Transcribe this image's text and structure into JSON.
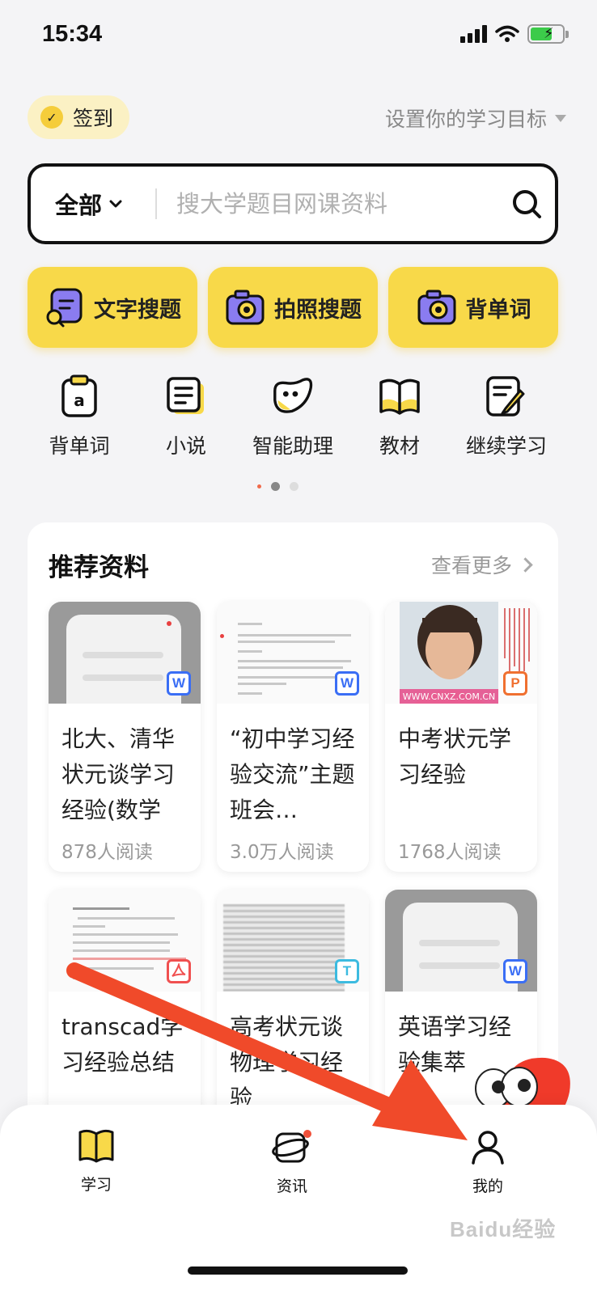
{
  "status": {
    "time": "15:34"
  },
  "checkin": {
    "label": "签到"
  },
  "goal": {
    "label": "设置你的学习目标"
  },
  "search": {
    "scope": "全部",
    "placeholder": "搜大学题目网课资料"
  },
  "big_actions": [
    {
      "label": "文字搜题",
      "icon": "text-search-icon"
    },
    {
      "label": "拍照搜题",
      "icon": "camera-icon"
    },
    {
      "label": "背单词",
      "icon": "camera-icon"
    }
  ],
  "quick_items": [
    {
      "label": "背单词",
      "icon": "vocabulary-icon"
    },
    {
      "label": "小说",
      "icon": "novel-icon"
    },
    {
      "label": "智能助理",
      "icon": "assistant-icon"
    },
    {
      "label": "教材",
      "icon": "textbook-icon"
    },
    {
      "label": "继续学习",
      "icon": "continue-study-icon"
    }
  ],
  "recommend": {
    "title": "推荐资料",
    "more": "查看更多",
    "docs": [
      {
        "title": "北大、清华状元谈学习经验(数学",
        "reads": "878人阅读",
        "type": "W"
      },
      {
        "title": "“初中学习经验交流”主题班会…",
        "reads": "3.0万人阅读",
        "type": "W"
      },
      {
        "title": "中考状元学习经验",
        "reads": "1768人阅读",
        "type": "P",
        "photo_caption": "WWW.CNXZ.COM.CN"
      },
      {
        "title": "transcad学习经验总结",
        "reads": "",
        "type": "PDF"
      },
      {
        "title": "高考状元谈物理学习经验",
        "reads": "",
        "type": "T"
      },
      {
        "title": "英语学习经验集萃",
        "reads": "",
        "type": "W"
      }
    ]
  },
  "tabs": [
    {
      "label": "学习",
      "icon": "book-icon"
    },
    {
      "label": "资讯",
      "icon": "news-icon"
    },
    {
      "label": "我的",
      "icon": "person-icon"
    }
  ],
  "watermark": "Baidu经验",
  "colors": {
    "accent": "#f8d949",
    "annotation_arrow": "#f04a2a"
  }
}
